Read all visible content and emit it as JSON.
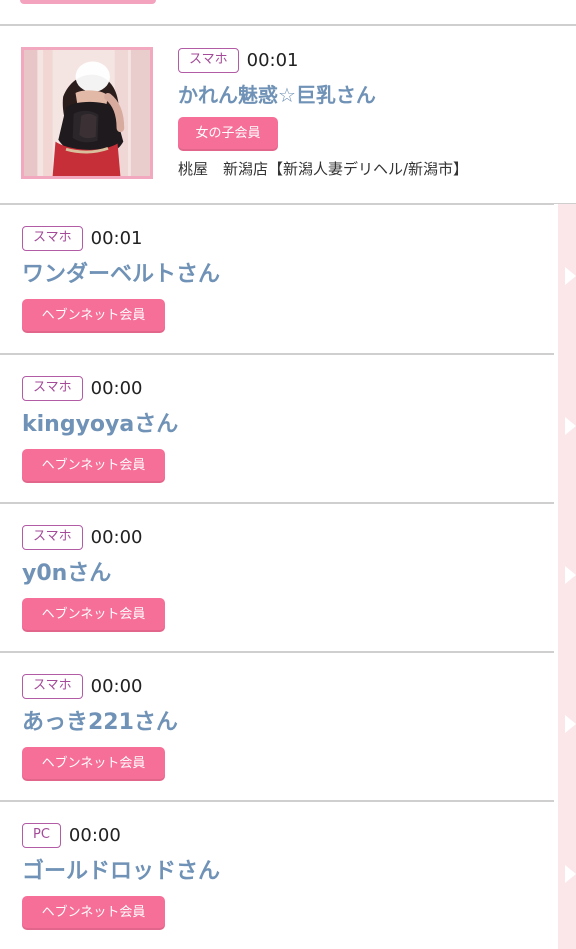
{
  "featured": {
    "device": "スマホ",
    "time": "00:01",
    "name": "かれん魅惑☆巨乳さん",
    "membership": "女の子会員",
    "shop": "桃屋　新潟店【新潟人妻デリヘル/新潟市】",
    "avatar": "woman-photo"
  },
  "entries": [
    {
      "device": "スマホ",
      "time": "00:01",
      "name": "ワンダーベルトさん",
      "membership": "ヘブンネット会員"
    },
    {
      "device": "スマホ",
      "time": "00:00",
      "name": "kingyoyaさん",
      "membership": "ヘブンネット会員"
    },
    {
      "device": "スマホ",
      "time": "00:00",
      "name": "y0nさん",
      "membership": "ヘブンネット会員"
    },
    {
      "device": "スマホ",
      "time": "00:00",
      "name": "あっき221さん",
      "membership": "ヘブンネット会員"
    },
    {
      "device": "PC",
      "time": "00:00",
      "name": "ゴールドロッドさん",
      "membership": "ヘブンネット会員"
    }
  ],
  "colors": {
    "name": "#6f92b6",
    "badge_border": "#b25ca5",
    "membership_bg": "#f66f98",
    "rail_bg": "#fbe7ea",
    "divider": "#cfcfcf"
  }
}
